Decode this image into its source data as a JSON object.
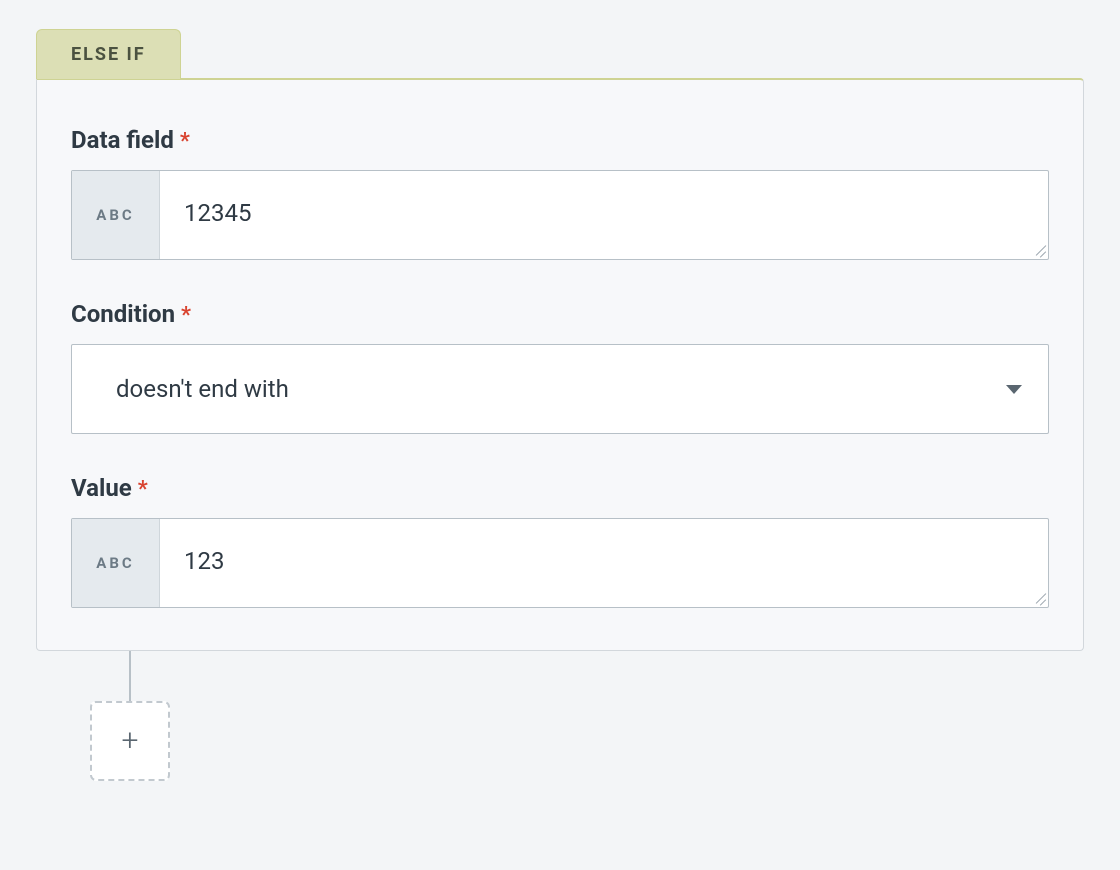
{
  "tab": {
    "label": "ELSE IF"
  },
  "fields": {
    "data_field": {
      "label": "Data field",
      "required": true,
      "type_badge": "ABC",
      "value": "12345"
    },
    "condition": {
      "label": "Condition",
      "required": true,
      "selected": "doesn't end with"
    },
    "value_field": {
      "label": "Value",
      "required": true,
      "type_badge": "ABC",
      "value": "123"
    }
  },
  "required_marker": "*",
  "add_button": {
    "glyph": "+"
  }
}
